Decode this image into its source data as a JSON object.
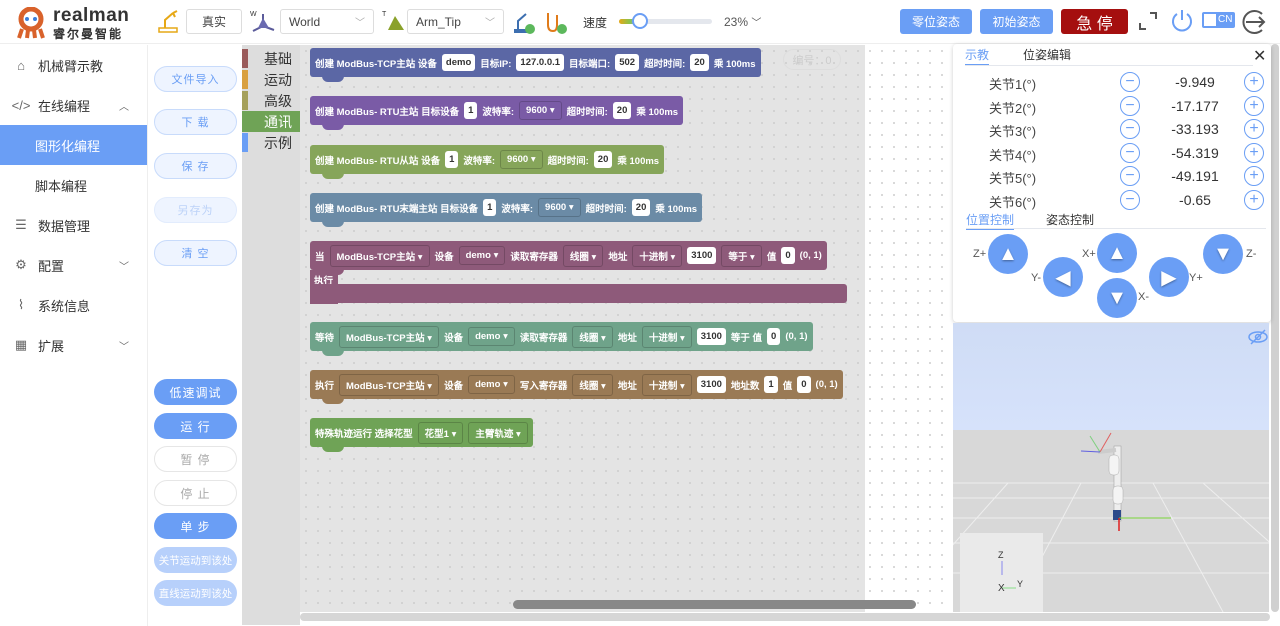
{
  "header": {
    "logo_text": "realman",
    "logo_sub": "睿尔曼智能",
    "mode": "真实",
    "frame_world": "World",
    "frame_tool": "Arm_Tip",
    "speed_label": "速度",
    "speed_value": "23%",
    "speed_fraction": 0.23,
    "zero_pose": "零位姿态",
    "init_pose": "初始姿态",
    "estop": "急 停",
    "lang": "CN",
    "colors": {
      "accent": "#6a9ef5",
      "estop": "#a50f0f"
    }
  },
  "sidebar": {
    "items": [
      {
        "label": "机械臂示教",
        "icon": "home-icon"
      },
      {
        "label": "在线编程",
        "icon": "code-monitor-icon"
      },
      {
        "label": "图形化编程"
      },
      {
        "label": "脚本编程"
      },
      {
        "label": "数据管理",
        "icon": "database-icon"
      },
      {
        "label": "配置",
        "icon": "gear-icon"
      },
      {
        "label": "系统信息",
        "icon": "pulse-icon"
      },
      {
        "label": "扩展",
        "icon": "grid-icon"
      }
    ]
  },
  "actions": {
    "import": "文件导入",
    "download": "下 载",
    "save": "保 存",
    "save_as": "另存为",
    "clear": "清 空",
    "slow_debug": "低速调试",
    "run": "运 行",
    "pause": "暂 停",
    "stop": "停 止",
    "step": "单 步",
    "joint_move": "关节运动到该处",
    "linear_move": "直线运动到该处"
  },
  "toolbox": {
    "categories": [
      {
        "label": "基础",
        "color": "#9a5b5b"
      },
      {
        "label": "运动",
        "color": "#d9a040"
      },
      {
        "label": "高级",
        "color": "#a5a05b"
      },
      {
        "label": "通讯",
        "color": "#6fa356"
      },
      {
        "label": "示例",
        "color": "#6a9ef5"
      }
    ]
  },
  "workspace": {
    "id_label": "编号：0"
  },
  "blocks": [
    {
      "color": "#5b67a5",
      "parts": [
        {
          "t": "创建 ModBus-TCP主站 设备"
        },
        {
          "f": "demo"
        },
        {
          "t": "目标IP:"
        },
        {
          "f": "127.0.0.1"
        },
        {
          "t": "目标端口:"
        },
        {
          "f": "502"
        },
        {
          "t": "超时时间:"
        },
        {
          "f": "20"
        },
        {
          "t": "乘 100ms"
        }
      ]
    },
    {
      "color": "#7a5ba6",
      "parts": [
        {
          "t": "创建 ModBus- RTU主站 目标设备"
        },
        {
          "f": "1"
        },
        {
          "t": "波特率:"
        },
        {
          "d": "9600"
        },
        {
          "t": "超时时间:"
        },
        {
          "f": "20"
        },
        {
          "t": "乘 100ms"
        }
      ]
    },
    {
      "color": "#86a55a",
      "parts": [
        {
          "t": "创建 ModBus- RTU从站 设备"
        },
        {
          "f": "1"
        },
        {
          "t": "波特率:"
        },
        {
          "d": "9600"
        },
        {
          "t": "超时时间:"
        },
        {
          "f": "20"
        },
        {
          "t": "乘 100ms"
        }
      ]
    },
    {
      "color": "#6b8ba6",
      "parts": [
        {
          "t": "创建 ModBus- RTU末端主站 目标设备"
        },
        {
          "f": "1"
        },
        {
          "t": "波特率:"
        },
        {
          "d": "9600"
        },
        {
          "t": "超时时间:"
        },
        {
          "f": "20"
        },
        {
          "t": "乘 100ms"
        }
      ]
    },
    {
      "color": "#8e5a7a",
      "c_label": "执行",
      "parts": [
        {
          "t": "当"
        },
        {
          "d": "ModBus-TCP主站"
        },
        {
          "t": "设备"
        },
        {
          "d": "demo"
        },
        {
          "t": "读取寄存器"
        },
        {
          "d": "线圈"
        },
        {
          "t": "地址"
        },
        {
          "d": "十进制"
        },
        {
          "f": "3100"
        },
        {
          "d": "等于"
        },
        {
          "t": "值"
        },
        {
          "f": "0"
        },
        {
          "t": "(0, 1)"
        }
      ]
    },
    {
      "color": "#6fa38a",
      "parts": [
        {
          "t": "等待"
        },
        {
          "d": "ModBus-TCP主站"
        },
        {
          "t": "设备"
        },
        {
          "d": "demo"
        },
        {
          "t": "读取寄存器"
        },
        {
          "d": "线圈"
        },
        {
          "t": "地址"
        },
        {
          "d": "十进制"
        },
        {
          "f": "3100"
        },
        {
          "t": "等于 值"
        },
        {
          "f": "0"
        },
        {
          "t": "(0, 1)"
        }
      ]
    },
    {
      "color": "#9a7a55",
      "parts": [
        {
          "t": "执行"
        },
        {
          "d": "ModBus-TCP主站"
        },
        {
          "t": "设备"
        },
        {
          "d": "demo"
        },
        {
          "t": "写入寄存器"
        },
        {
          "d": "线圈"
        },
        {
          "t": "地址"
        },
        {
          "d": "十进制"
        },
        {
          "f": "3100"
        },
        {
          "t": "地址数"
        },
        {
          "f": "1"
        },
        {
          "t": "值"
        },
        {
          "f": "0"
        },
        {
          "t": "(0, 1)"
        }
      ]
    },
    {
      "color": "#6fa356",
      "parts": [
        {
          "t": "特殊轨迹运行 选择花型"
        },
        {
          "d": "花型1"
        },
        {
          "d": "主臂轨迹"
        }
      ]
    }
  ],
  "teach_panel": {
    "tabs": [
      "示教",
      "位姿编辑"
    ],
    "joints": [
      {
        "label": "关节1(°)",
        "value": "-9.949"
      },
      {
        "label": "关节2(°)",
        "value": "-17.177"
      },
      {
        "label": "关节3(°)",
        "value": "-33.193"
      },
      {
        "label": "关节4(°)",
        "value": "-54.319"
      },
      {
        "label": "关节5(°)",
        "value": "-49.191"
      },
      {
        "label": "关节6(°)",
        "value": "-0.65"
      }
    ],
    "control_tabs": [
      "位置控制",
      "姿态控制"
    ],
    "axes": {
      "zp": "Z+",
      "zm": "Z-",
      "xp": "X+",
      "xm": "X-",
      "yp": "Y+",
      "ym": "Y-"
    }
  },
  "viewer": {
    "axis_z": "Z",
    "axis_x": "X",
    "axis_y": "Y"
  }
}
